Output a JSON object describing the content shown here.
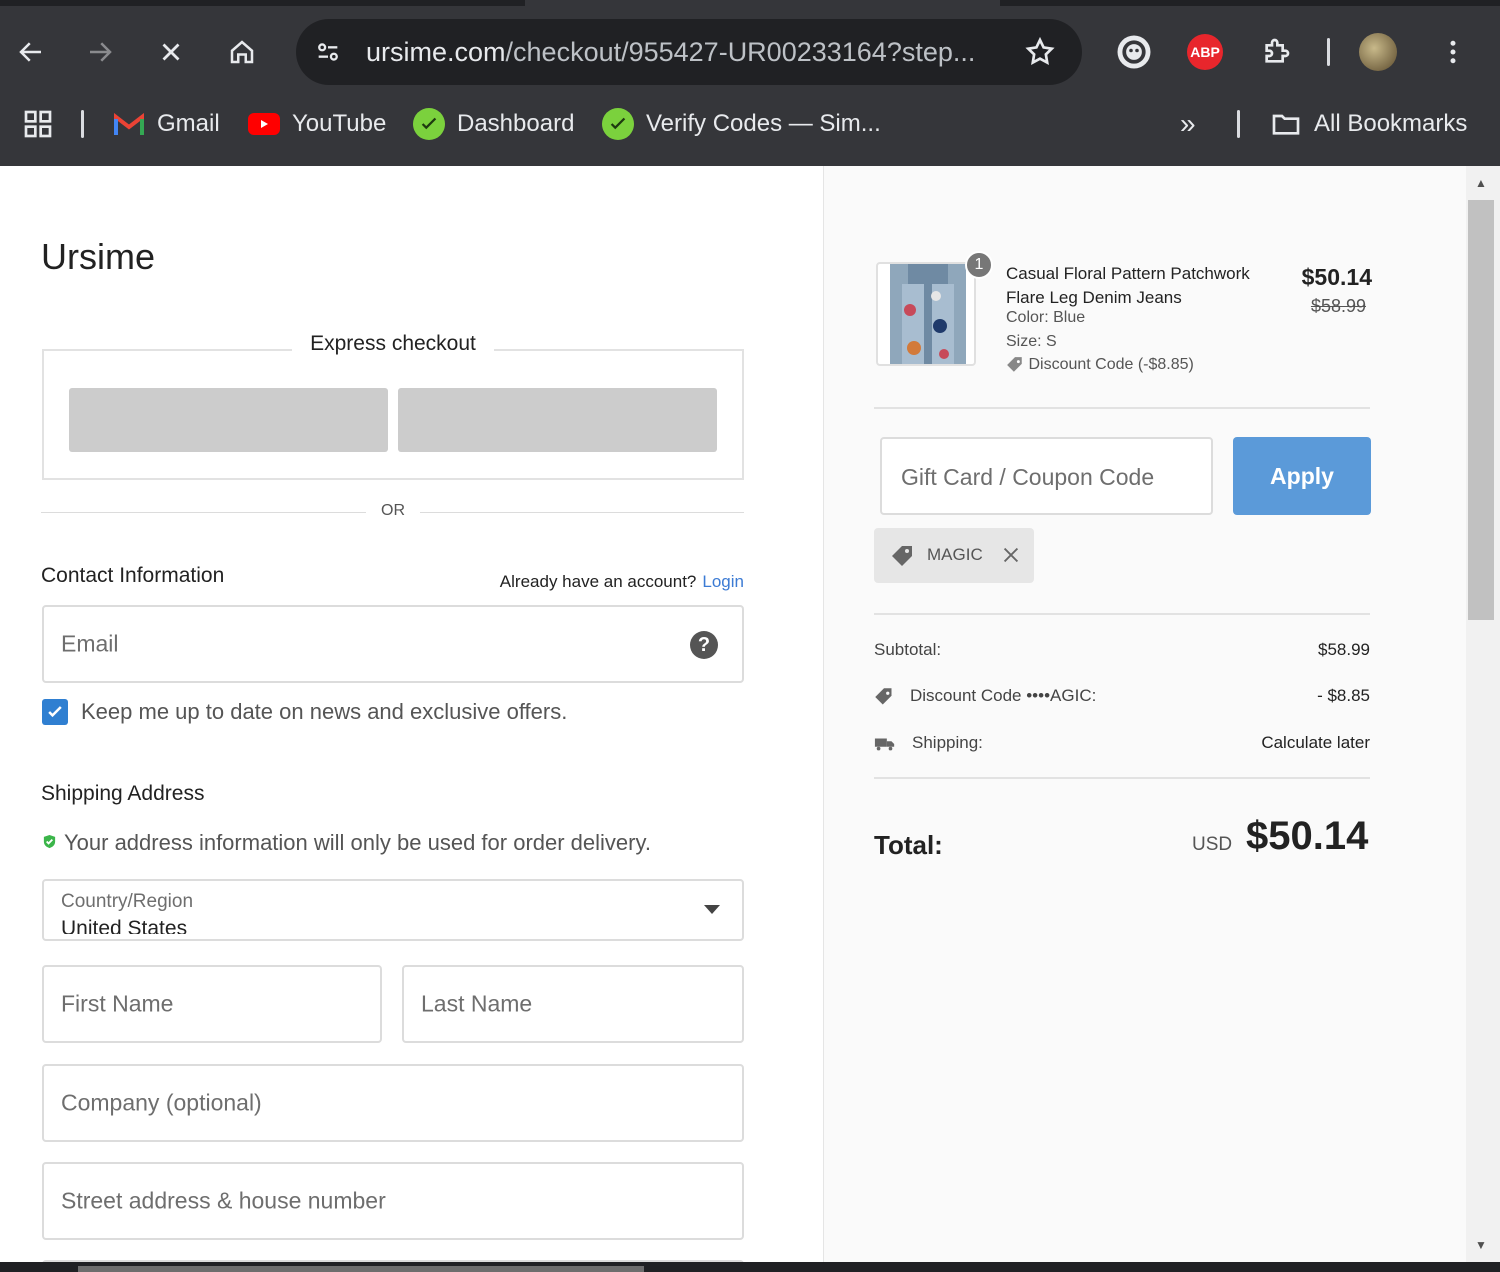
{
  "browser": {
    "url_host": "ursime.com",
    "url_path": "/checkout/955427-UR00233164?step...",
    "bookmarks": [
      {
        "label": "Gmail"
      },
      {
        "label": "YouTube"
      },
      {
        "label": "Dashboard"
      },
      {
        "label": "Verify Codes — Sim..."
      }
    ],
    "more_bookmarks": "»",
    "all_bookmarks": "All Bookmarks",
    "abp_label": "ABP"
  },
  "checkout": {
    "brand": "Ursime",
    "express_title": "Express checkout",
    "or_text": "OR",
    "contact_title": "Contact Information",
    "account_question": "Already have an account?",
    "login_link": "Login",
    "email_placeholder": "Email",
    "newsletter_label": "Keep me up to date on news and exclusive offers.",
    "newsletter_checked": true,
    "shipping_title": "Shipping Address",
    "secure_note": "Your address information will only be used for order delivery.",
    "country_label": "Country/Region",
    "country_value": "United States",
    "first_name_placeholder": "First Name",
    "last_name_placeholder": "Last Name",
    "company_placeholder": "Company (optional)",
    "street_placeholder": "Street address & house number"
  },
  "summary": {
    "item": {
      "quantity": "1",
      "name": "Casual Floral Pattern Patchwork Flare Leg Denim Jeans",
      "color": "Color: Blue",
      "size": "Size: S",
      "discount": "Discount Code  (-$8.85)",
      "price": "$50.14",
      "original_price": "$58.99"
    },
    "coupon_placeholder": "Gift Card / Coupon Code",
    "apply_label": "Apply",
    "applied_code": "MAGIC",
    "subtotal_label": "Subtotal:",
    "subtotal_value": "$58.99",
    "discount_label": "Discount Code  ••••AGIC:",
    "discount_value": "- $8.85",
    "shipping_label": "Shipping:",
    "shipping_value": "Calculate later",
    "total_label": "Total:",
    "total_currency": "USD",
    "total_value": "$50.14"
  },
  "colors": {
    "accent_blue": "#2f7fd1",
    "apply_blue": "#5b9ad9",
    "chrome_dark": "#35363a"
  }
}
